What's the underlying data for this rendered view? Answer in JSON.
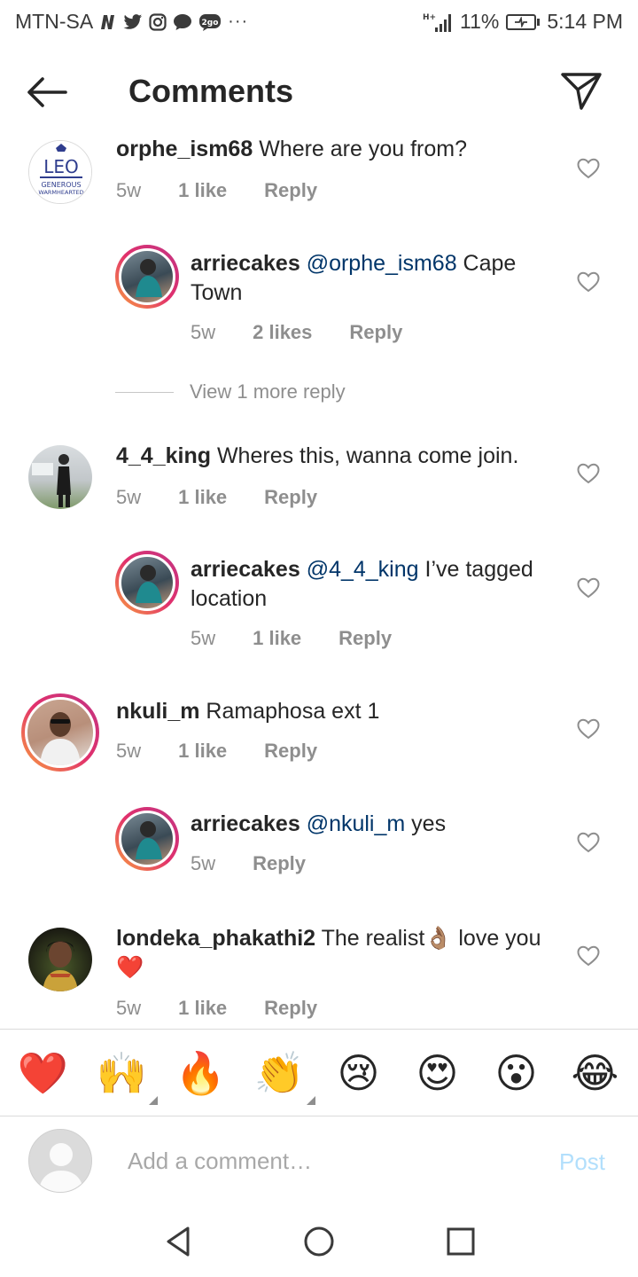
{
  "status_bar": {
    "carrier": "MTN-SA",
    "network": "H+",
    "battery": "11%",
    "time": "5:14 PM"
  },
  "header": {
    "title": "Comments"
  },
  "comments": [
    {
      "username": "orphe_ism68",
      "mention": "",
      "text": " Where are you from?",
      "age": "5w",
      "likes": "1 like",
      "reply": "Reply",
      "avatar_text": "LEO",
      "avatar_sub1": "GENEROUS",
      "avatar_sub2": "WARMHEARTED"
    },
    {
      "username": "arriecakes",
      "mention": "@orphe_ism68",
      "text": " Cape Town",
      "age": "5w",
      "likes": "2 likes",
      "reply": "Reply"
    },
    {
      "view_more": "View 1 more reply"
    },
    {
      "username": "4_4_king",
      "mention": "",
      "text": " Wheres this, wanna come join.",
      "age": "5w",
      "likes": "1 like",
      "reply": "Reply"
    },
    {
      "username": "arriecakes",
      "mention": "@4_4_king",
      "text": " I’ve tagged location",
      "age": "5w",
      "likes": "1 like",
      "reply": "Reply"
    },
    {
      "username": "nkuli_m",
      "mention": "",
      "text": " Ramaphosa ext 1",
      "age": "5w",
      "likes": "1 like",
      "reply": "Reply"
    },
    {
      "username": "arriecakes",
      "mention": "@nkuli_m",
      "text": " yes",
      "age": "5w",
      "likes": "",
      "reply": "Reply"
    },
    {
      "username": "londeka_phakathi2",
      "mention": "",
      "text": " The realist👌🏽 love you ❤️",
      "age": "5w",
      "likes": "1 like",
      "reply": "Reply"
    }
  ],
  "quick_emojis": [
    "❤️",
    "🙌",
    "🔥",
    "👏",
    "😢",
    "😍",
    "😮",
    "😂"
  ],
  "composer": {
    "placeholder": "Add a comment…",
    "post_label": "Post"
  },
  "colors": {
    "text": "#262626",
    "secondary": "#8e8e8e",
    "mention": "#003569",
    "post_disabled": "#b2dffc",
    "heart": "#ed4956"
  }
}
